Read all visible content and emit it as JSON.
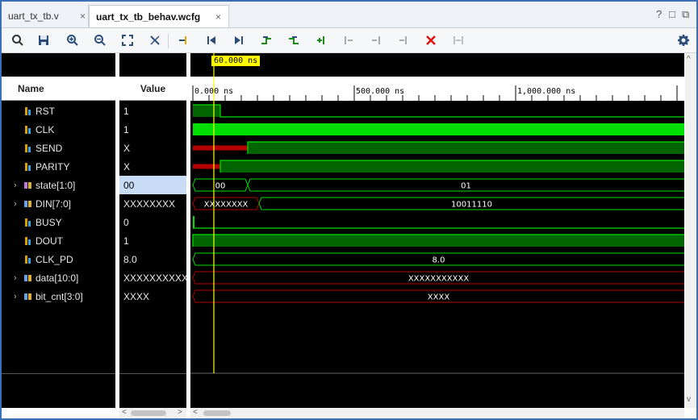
{
  "tabs": [
    {
      "label": "uart_tx_tb.v",
      "close": "×",
      "active": false
    },
    {
      "label": "uart_tx_tb_behav.wcfg",
      "close": "×",
      "active": true
    }
  ],
  "window_controls": {
    "help": "?",
    "restore": "□",
    "float": "⧉"
  },
  "toolbar": {
    "icons": [
      "search-icon",
      "save-icon",
      "zoom-in-icon",
      "zoom-out-icon",
      "zoom-fit-icon",
      "cursor-icon",
      "go-to-time-icon",
      "go-to-start-icon",
      "go-to-end-icon",
      "previous-transition-icon",
      "next-transition-icon",
      "add-marker-icon",
      "previous-marker-icon",
      "next-marker-icon",
      "remove-marker-icon",
      "delete-icon",
      "swap-cursors-icon",
      "settings-icon"
    ]
  },
  "columns": {
    "name": "Name",
    "value": "Value"
  },
  "cursor": {
    "label": "60.000 ns"
  },
  "ruler": {
    "ticks": [
      "0.000 ns",
      "500.000 ns",
      "1,000.000 ns"
    ]
  },
  "signals": [
    {
      "name": "RST",
      "value": "1",
      "expandable": false,
      "kind": "bit",
      "selected": false,
      "wave_label_a": "",
      "wave_label_b": ""
    },
    {
      "name": "CLK",
      "value": "1",
      "expandable": false,
      "kind": "bit",
      "selected": false,
      "wave_label_a": "",
      "wave_label_b": ""
    },
    {
      "name": "SEND",
      "value": "X",
      "expandable": false,
      "kind": "bit",
      "selected": false,
      "wave_label_a": "",
      "wave_label_b": ""
    },
    {
      "name": "PARITY",
      "value": "X",
      "expandable": false,
      "kind": "bit",
      "selected": false,
      "wave_label_a": "",
      "wave_label_b": ""
    },
    {
      "name": "state[1:0]",
      "value": "00",
      "expandable": true,
      "kind": "bus-enum",
      "selected": true,
      "wave_label_a": "00",
      "wave_label_b": "01"
    },
    {
      "name": "DIN[7:0]",
      "value": "XXXXXXXX",
      "expandable": true,
      "kind": "bus",
      "selected": false,
      "wave_label_a": "XXXXXXXX",
      "wave_label_b": "10011110"
    },
    {
      "name": "BUSY",
      "value": "0",
      "expandable": false,
      "kind": "bit",
      "selected": false,
      "wave_label_a": "",
      "wave_label_b": ""
    },
    {
      "name": "DOUT",
      "value": "1",
      "expandable": false,
      "kind": "bit-out",
      "selected": false,
      "wave_label_a": "",
      "wave_label_b": ""
    },
    {
      "name": "CLK_PD",
      "value": "8.0",
      "expandable": false,
      "kind": "real",
      "selected": false,
      "wave_label_a": "8.0",
      "wave_label_b": ""
    },
    {
      "name": "data[10:0]",
      "value": "XXXXXXXXXXX",
      "expandable": true,
      "kind": "bus",
      "selected": false,
      "wave_label_a": "XXXXXXXXXXX",
      "wave_label_b": ""
    },
    {
      "name": "bit_cnt[3:0]",
      "value": "XXXX",
      "expandable": true,
      "kind": "bus",
      "selected": false,
      "wave_label_a": "XXXX",
      "wave_label_b": ""
    }
  ],
  "colors": {
    "wave_green": "#00e000",
    "wave_dark_green": "#006400",
    "wave_x_red": "#b40000",
    "cursor": "#ffff00",
    "selection": "#c9dcf5"
  },
  "scroll": {
    "left": "<",
    "right": ">",
    "up": "^",
    "down": "v"
  }
}
